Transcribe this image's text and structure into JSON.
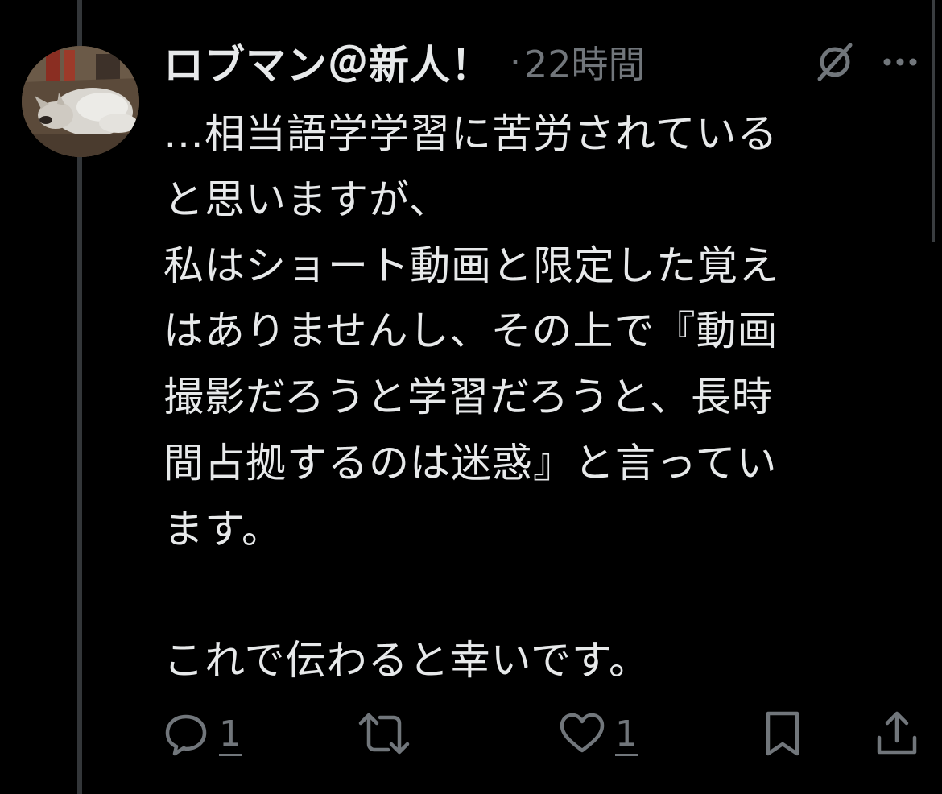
{
  "tweet": {
    "display_name": "ロブマン＠新人！",
    "separator": "·",
    "timestamp": "22時間",
    "body": "…相当語学学習に苦労されている\nと思いますが、\n私はショート動画と限定した覚え\nはありませんし、その上で『動画\n撮影だろうと学習だろうと、長時\n間占拠するのは迷惑』と言ってい\nます。\n\nこれで伝わると幸いです。",
    "avatar_icon": "fox-avatar",
    "grok_icon": "grok-icon",
    "more_icon": "more-icon"
  },
  "actions": {
    "reply_icon": "reply-icon",
    "reply_count": "1",
    "retweet_icon": "retweet-icon",
    "like_icon": "heart-icon",
    "like_count": "1",
    "bookmark_icon": "bookmark-icon",
    "share_icon": "share-icon"
  },
  "colors": {
    "background": "#000000",
    "text_primary": "#e7e9ea",
    "text_secondary": "#71767b",
    "thread_line": "#333639"
  }
}
